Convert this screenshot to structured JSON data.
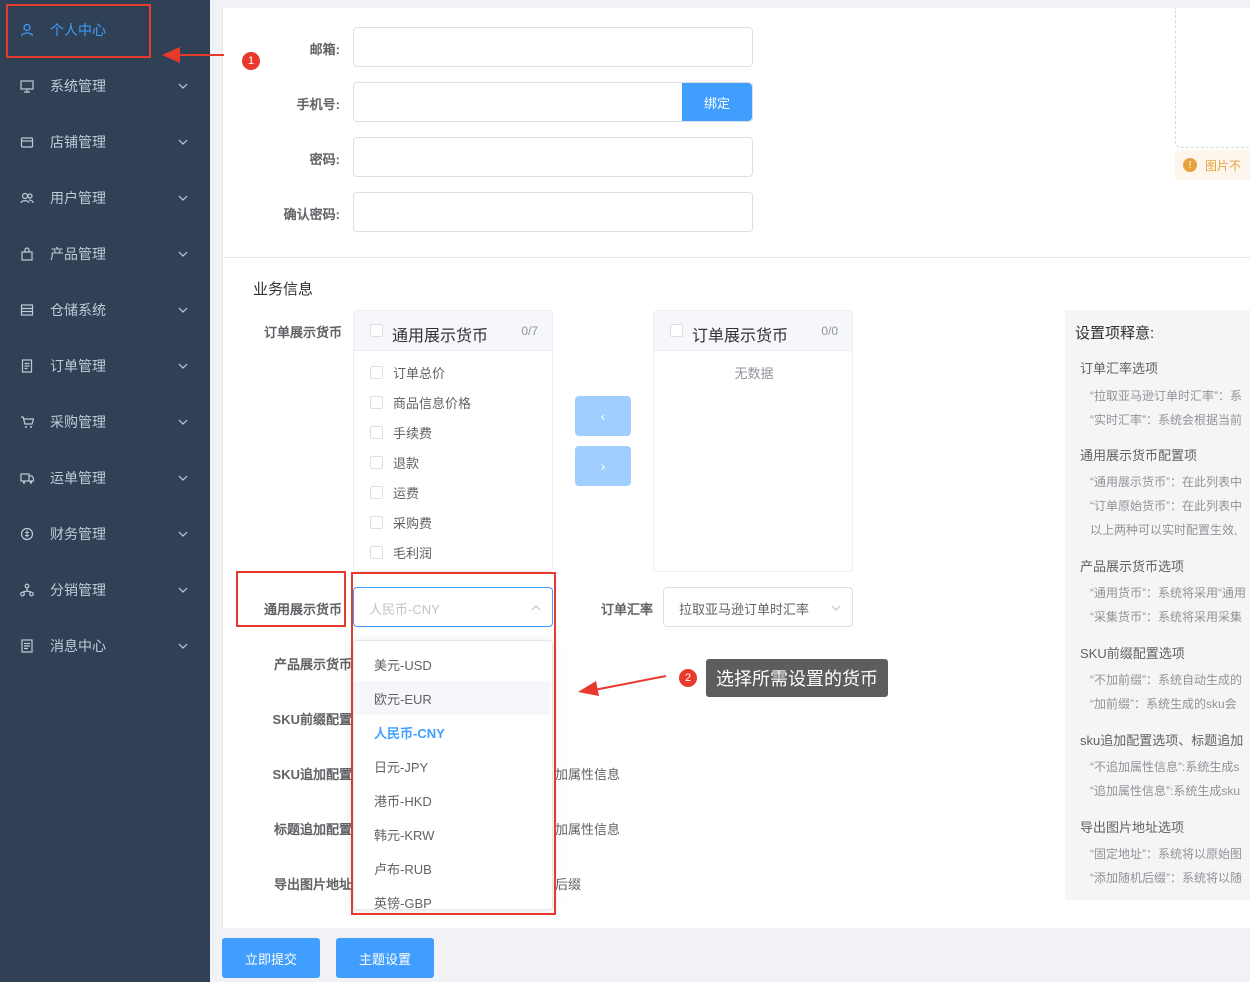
{
  "sidebar": {
    "items": [
      {
        "label": "个人中心",
        "icon": "user-icon"
      },
      {
        "label": "系统管理",
        "icon": "monitor-icon"
      },
      {
        "label": "店铺管理",
        "icon": "shop-icon"
      },
      {
        "label": "用户管理",
        "icon": "users-icon"
      },
      {
        "label": "产品管理",
        "icon": "bag-icon"
      },
      {
        "label": "仓储系统",
        "icon": "warehouse-icon"
      },
      {
        "label": "订单管理",
        "icon": "document-icon"
      },
      {
        "label": "采购管理",
        "icon": "cart-icon"
      },
      {
        "label": "运单管理",
        "icon": "truck-icon"
      },
      {
        "label": "财务管理",
        "icon": "finance-icon"
      },
      {
        "label": "分销管理",
        "icon": "network-icon"
      },
      {
        "label": "消息中心",
        "icon": "message-icon"
      }
    ]
  },
  "account": {
    "email_label": "邮箱:",
    "phone_label": "手机号:",
    "bind_button": "绑定",
    "password_label": "密码:",
    "confirm_label": "确认密码:"
  },
  "upload": {
    "warning": "图片不"
  },
  "business": {
    "section_title": "业务信息",
    "order_currency_label": "订单展示货币",
    "left_panel": {
      "title": "通用展示货币",
      "count": "0/7",
      "items": [
        "订单总价",
        "商品信息价格",
        "手续费",
        "退款",
        "运费",
        "采购费",
        "毛利润"
      ]
    },
    "right_panel": {
      "title": "订单展示货币",
      "count": "0/0",
      "empty": "无数据"
    },
    "arrow_left": "‹",
    "arrow_right": "›",
    "general_currency_label": "通用展示货币",
    "general_currency_value": "人民币-CNY",
    "exchange_label": "订单汇率",
    "exchange_value": "拉取亚马逊订单时汇率",
    "product_currency_label": "产品展示货币",
    "sku_prefix_label": "SKU前缀配置",
    "sku_append_label": "SKU追加配置",
    "sku_append_partial": "加属性信息",
    "title_append_label": "标题追加配置",
    "title_append_partial": "加属性信息",
    "export_label": "导出图片地址",
    "export_partial": "后缀"
  },
  "dropdown": {
    "options": [
      "美元-USD",
      "欧元-EUR",
      "人民币-CNY",
      "日元-JPY",
      "港币-HKD",
      "韩元-KRW",
      "卢布-RUB",
      "英镑-GBP"
    ],
    "hovered": "欧元-EUR",
    "selected": "人民币-CNY"
  },
  "annotations": {
    "badge1": "1",
    "badge2": "2",
    "tooltip": "选择所需设置的货币"
  },
  "help": {
    "title": "设置项释意:",
    "sections": [
      {
        "heading": "订单汇率选项",
        "lines": [
          "“拉取亚马逊订单时汇率”：系",
          "“实时汇率”：系统会根据当前"
        ]
      },
      {
        "heading": "通用展示货币配置项",
        "lines": [
          "“通用展示货币”：在此列表中",
          "“订单原始货币”：在此列表中",
          "以上两种可以实时配置生效,"
        ]
      },
      {
        "heading": "产品展示货币选项",
        "lines": [
          "“通用货币”：系统将采用“通用",
          "“采集货币”：系统将采用采集"
        ]
      },
      {
        "heading": "SKU前缀配置选项",
        "lines": [
          "“不加前缀”：系统自动生成的",
          "“加前缀”：系统生成的sku会"
        ]
      },
      {
        "heading": "sku追加配置选项、标题追加",
        "lines": [
          "“不追加属性信息”:系统生成s",
          "“追加属性信息”:系统生成sku"
        ]
      },
      {
        "heading": "导出图片地址选项",
        "lines": [
          "“固定地址”：系统将以原始图",
          "“添加随机后缀”：系统将以随"
        ]
      }
    ]
  },
  "footer": {
    "submit": "立即提交",
    "theme": "主题设置"
  },
  "colors": {
    "sidebar_bg": "#304156",
    "primary": "#409eff",
    "annotation_red": "#e8392d"
  }
}
